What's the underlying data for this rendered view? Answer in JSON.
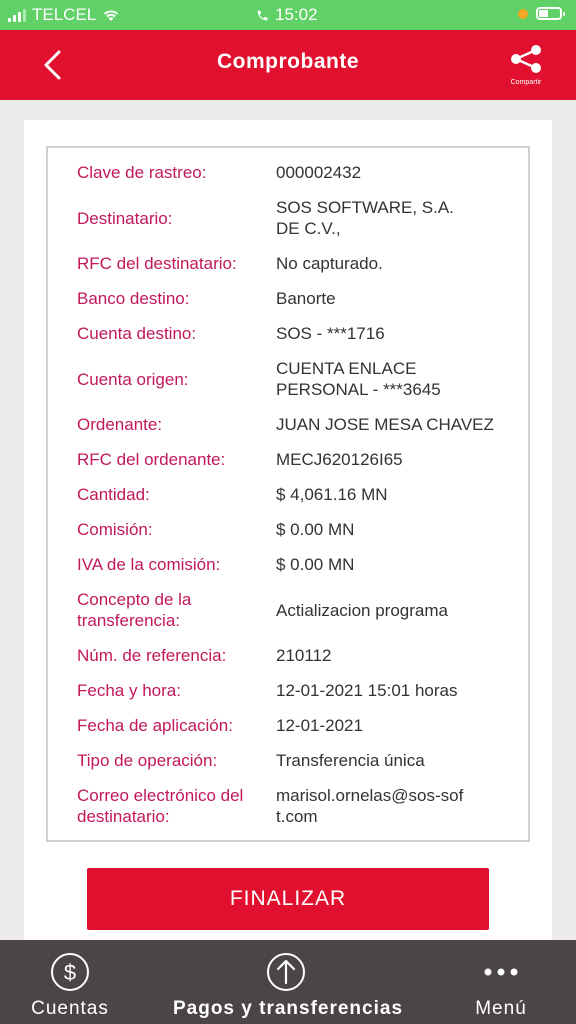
{
  "status_bar": {
    "carrier": "TELCEL",
    "time": "15:02"
  },
  "header": {
    "title": "Comprobante",
    "share_label": "Compartir"
  },
  "details": [
    {
      "label": "Clave de rastreo:",
      "value": "000002432"
    },
    {
      "label": "Destinatario:",
      "value": "SOS SOFTWARE, S.A. DE C.V.,"
    },
    {
      "label": "RFC del destinatario:",
      "value": "No capturado."
    },
    {
      "label": "Banco destino:",
      "value": "Banorte"
    },
    {
      "label": "Cuenta destino:",
      "value": "SOS - ***1716"
    },
    {
      "label": "Cuenta origen:",
      "value": "CUENTA ENLACE PERSONAL - ***3645"
    },
    {
      "label": "Ordenante:",
      "value": "JUAN JOSE MESA CHAVEZ"
    },
    {
      "label": "RFC del ordenante:",
      "value": "MECJ620126I65"
    },
    {
      "label": "Cantidad:",
      "value": "$ 4,061.16 MN"
    },
    {
      "label": "Comisión:",
      "value": "$ 0.00 MN"
    },
    {
      "label": "IVA de la comisión:",
      "value": "$ 0.00 MN"
    },
    {
      "label": "Concepto de la transferencia:",
      "value": "Actializacion programa"
    },
    {
      "label": "Núm. de referencia:",
      "value": "210112"
    },
    {
      "label": "Fecha y hora:",
      "value": "12-01-2021 15:01 horas"
    },
    {
      "label": "Fecha de aplicación:",
      "value": "12-01-2021"
    },
    {
      "label": "Tipo de operación:",
      "value": "Transferencia única"
    },
    {
      "label": "Correo electrónico del destinatario:",
      "value": "marisol.ornelas@sos-soft.com"
    }
  ],
  "finalize_label": "FINALIZAR",
  "bottom_nav": [
    {
      "label": "Cuentas",
      "icon": "dollar-circle-icon",
      "active": false
    },
    {
      "label": "Pagos y transferencias",
      "icon": "arrow-up-circle-icon",
      "active": true
    },
    {
      "label": "Menú",
      "icon": "more-dots-icon",
      "active": false
    }
  ],
  "colors": {
    "brand_red": "#e0102e",
    "label_magenta": "#c2185b",
    "status_green": "#5fd166",
    "nav_bg": "#4b4545"
  }
}
